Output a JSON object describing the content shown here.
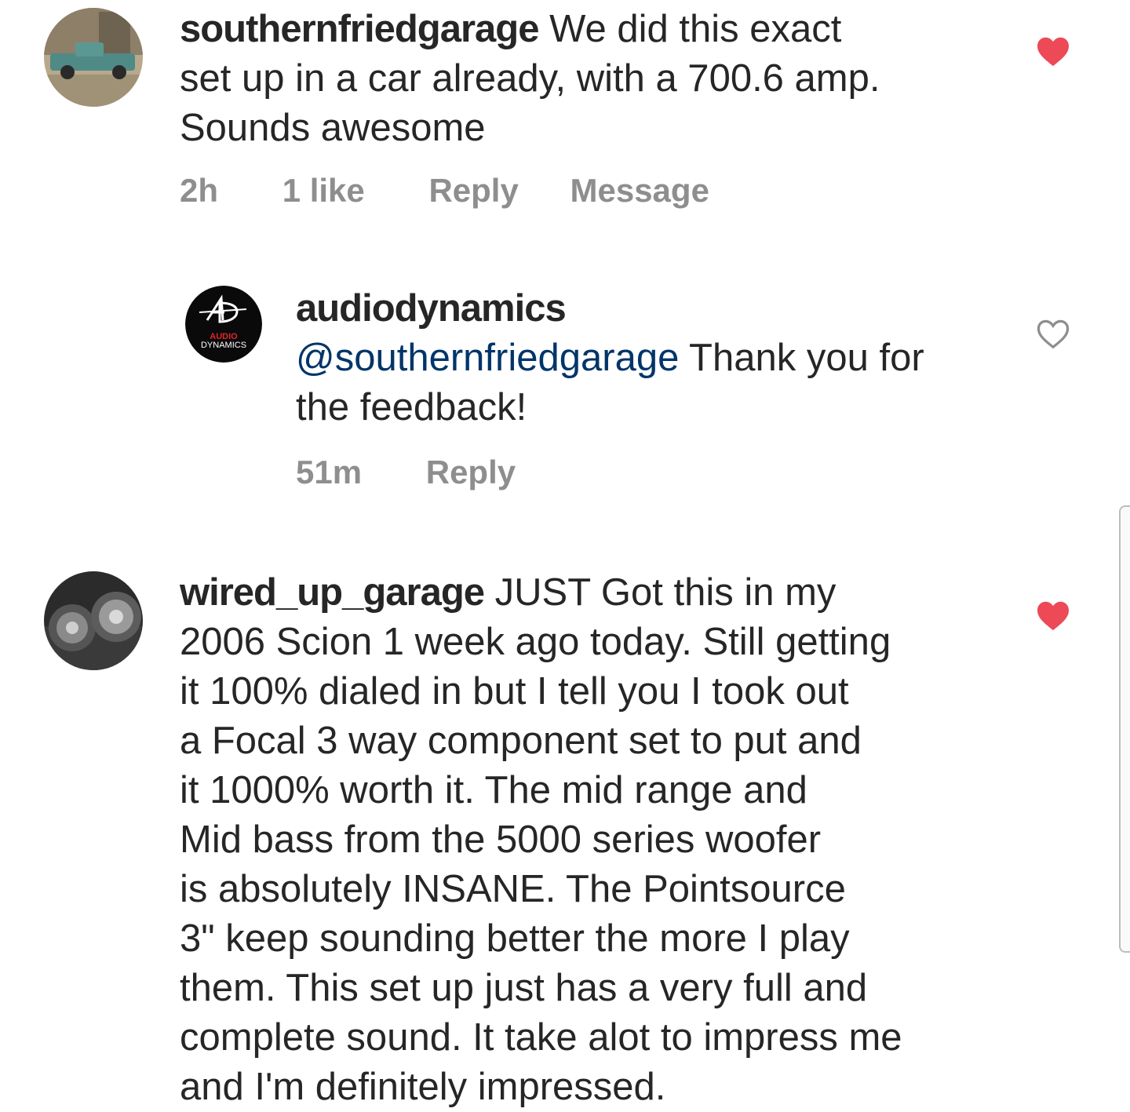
{
  "comments": [
    {
      "username": "southernfriedgarage",
      "text_lines": [
        " We did this exact",
        "set up in a car already, with a 700.6 amp.",
        "Sounds awesome"
      ],
      "time": "2h",
      "likes": "1 like",
      "reply_label": "Reply",
      "message_label": "Message",
      "liked": true
    },
    {
      "username": "audiodynamics",
      "mention": "@southernfriedgarage",
      "text_lines": [
        " Thank you for",
        "the feedback!"
      ],
      "time": "51m",
      "reply_label": "Reply",
      "liked": false,
      "avatar_text_top": "AUDIO",
      "avatar_text_bottom": "DYNAMICS"
    },
    {
      "username": "wired_up_garage",
      "text_lines": [
        " JUST Got this in my",
        "2006 Scion 1 week ago today. Still getting",
        "it 100% dialed in but I tell you I took out",
        "a Focal 3 way component set to put  and",
        "it 1000% worth it. The mid range and",
        "Mid bass from the 5000 series woofer",
        "is absolutely INSANE. The Pointsource",
        "3\" keep sounding better the more I play",
        "them. This set up just has a very full and",
        "complete sound. It take alot to impress me",
        "and I'm definitely impressed."
      ],
      "liked": true
    }
  ],
  "colors": {
    "heart_liked": "#ed4956",
    "heart_outline": "#8e8e8e",
    "mention": "#003569",
    "meta": "#8e8e8e"
  }
}
